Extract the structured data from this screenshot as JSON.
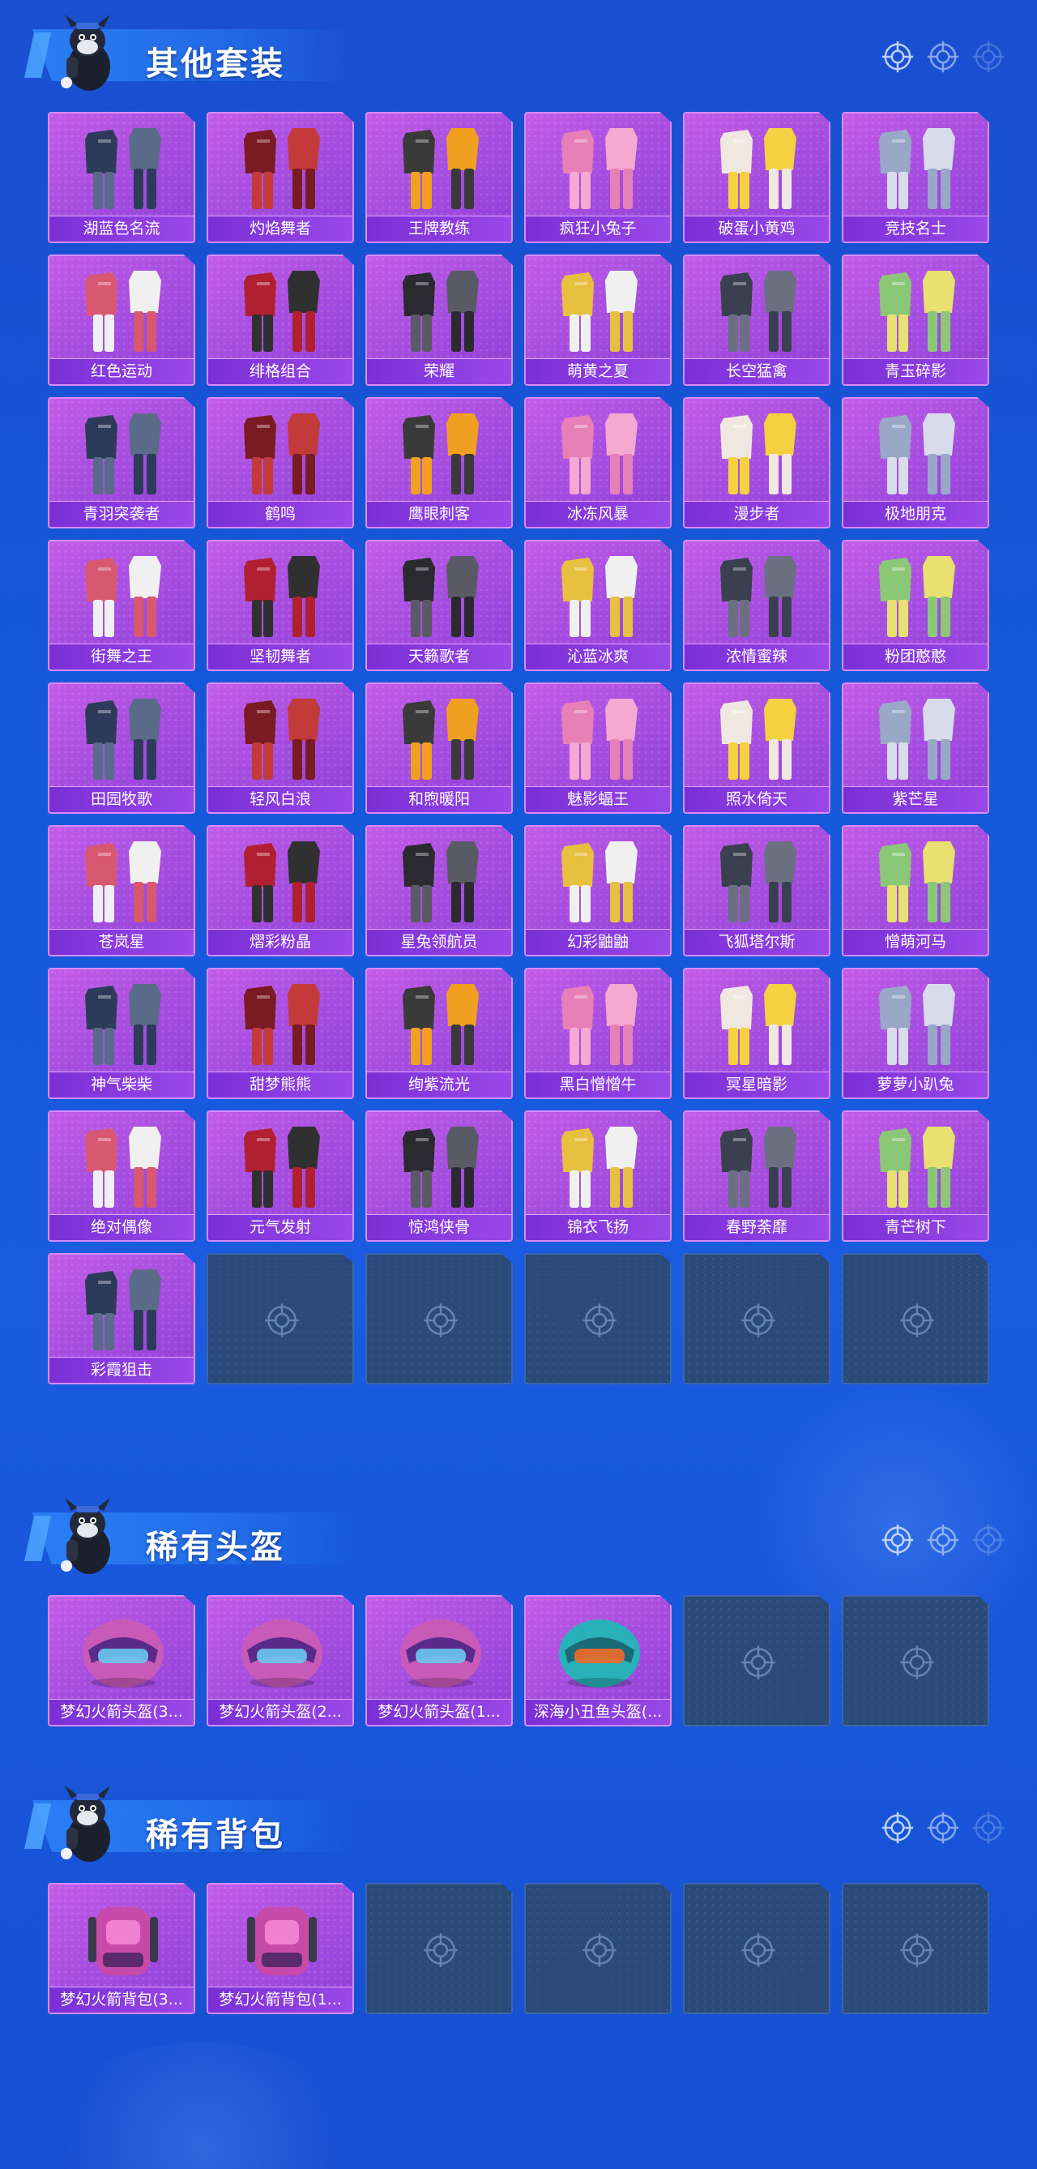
{
  "colors": {
    "background": "#1a55d8",
    "card_purple": "#a84fe0",
    "card_label": "#8a3ee0",
    "empty_slot": "#2a4a7a"
  },
  "sections": [
    {
      "title": "其他套装",
      "items": [
        {
          "label": "湖蓝色名流",
          "icon": "outfit-icon"
        },
        {
          "label": "灼焰舞者",
          "icon": "outfit-icon"
        },
        {
          "label": "王牌教练",
          "icon": "outfit-icon"
        },
        {
          "label": "疯狂小兔子",
          "icon": "outfit-icon"
        },
        {
          "label": "破蛋小黄鸡",
          "icon": "outfit-icon"
        },
        {
          "label": "竞技名士",
          "icon": "outfit-icon"
        },
        {
          "label": "红色运动",
          "icon": "outfit-icon"
        },
        {
          "label": "绯格组合",
          "icon": "outfit-icon"
        },
        {
          "label": "荣耀",
          "icon": "outfit-icon"
        },
        {
          "label": "萌黄之夏",
          "icon": "outfit-icon"
        },
        {
          "label": "长空猛禽",
          "icon": "outfit-icon"
        },
        {
          "label": "青玉碎影",
          "icon": "outfit-icon"
        },
        {
          "label": "青羽突袭者",
          "icon": "outfit-icon"
        },
        {
          "label": "鹤鸣",
          "icon": "outfit-icon"
        },
        {
          "label": "鹰眼刺客",
          "icon": "outfit-icon"
        },
        {
          "label": "冰冻风暴",
          "icon": "outfit-icon"
        },
        {
          "label": "漫步者",
          "icon": "outfit-icon"
        },
        {
          "label": "极地朋克",
          "icon": "outfit-icon"
        },
        {
          "label": "街舞之王",
          "icon": "outfit-icon"
        },
        {
          "label": "坚韧舞者",
          "icon": "outfit-icon"
        },
        {
          "label": "天籁歌者",
          "icon": "outfit-icon"
        },
        {
          "label": "沁蓝冰爽",
          "icon": "outfit-icon"
        },
        {
          "label": "浓情蜜辣",
          "icon": "outfit-icon"
        },
        {
          "label": "粉团憨憨",
          "icon": "outfit-icon"
        },
        {
          "label": "田园牧歌",
          "icon": "outfit-icon"
        },
        {
          "label": "轻风白浪",
          "icon": "outfit-icon"
        },
        {
          "label": "和煦暖阳",
          "icon": "outfit-icon"
        },
        {
          "label": "魅影蝠王",
          "icon": "outfit-icon"
        },
        {
          "label": "照水倚天",
          "icon": "outfit-icon"
        },
        {
          "label": "紫芒星",
          "icon": "outfit-icon"
        },
        {
          "label": "苍岚星",
          "icon": "outfit-icon"
        },
        {
          "label": "熠彩粉晶",
          "icon": "outfit-icon"
        },
        {
          "label": "星兔领航员",
          "icon": "outfit-icon"
        },
        {
          "label": "幻彩鼬鼬",
          "icon": "outfit-icon"
        },
        {
          "label": "飞狐塔尔斯",
          "icon": "outfit-icon"
        },
        {
          "label": "憎萌河马",
          "icon": "outfit-icon"
        },
        {
          "label": "神气柴柴",
          "icon": "outfit-icon"
        },
        {
          "label": "甜梦熊熊",
          "icon": "outfit-icon"
        },
        {
          "label": "绚紫流光",
          "icon": "outfit-icon"
        },
        {
          "label": "黑白憎憎牛",
          "icon": "outfit-icon"
        },
        {
          "label": "冥星暗影",
          "icon": "outfit-icon"
        },
        {
          "label": "萝萝小趴兔",
          "icon": "outfit-icon"
        },
        {
          "label": "绝对偶像",
          "icon": "outfit-icon"
        },
        {
          "label": "元气发射",
          "icon": "outfit-icon"
        },
        {
          "label": "惊鸿侠骨",
          "icon": "outfit-icon"
        },
        {
          "label": "锦衣飞扬",
          "icon": "outfit-icon"
        },
        {
          "label": "春野荼靡",
          "icon": "outfit-icon"
        },
        {
          "label": "青芒树下",
          "icon": "outfit-icon"
        },
        {
          "label": "彩霞狙击",
          "icon": "outfit-icon"
        }
      ],
      "empty_slots": 5
    },
    {
      "title": "稀有头盔",
      "items": [
        {
          "label": "梦幻火箭头盔(3...",
          "icon": "helmet-icon"
        },
        {
          "label": "梦幻火箭头盔(2...",
          "icon": "helmet-icon"
        },
        {
          "label": "梦幻火箭头盔(1...",
          "icon": "helmet-icon"
        },
        {
          "label": "深海小丑鱼头盔(...",
          "icon": "helmet-icon"
        }
      ],
      "empty_slots": 2
    },
    {
      "title": "稀有背包",
      "items": [
        {
          "label": "梦幻火箭背包(3...",
          "icon": "backpack-icon"
        },
        {
          "label": "梦幻火箭背包(1...",
          "icon": "backpack-icon"
        }
      ],
      "empty_slots": 4
    }
  ]
}
